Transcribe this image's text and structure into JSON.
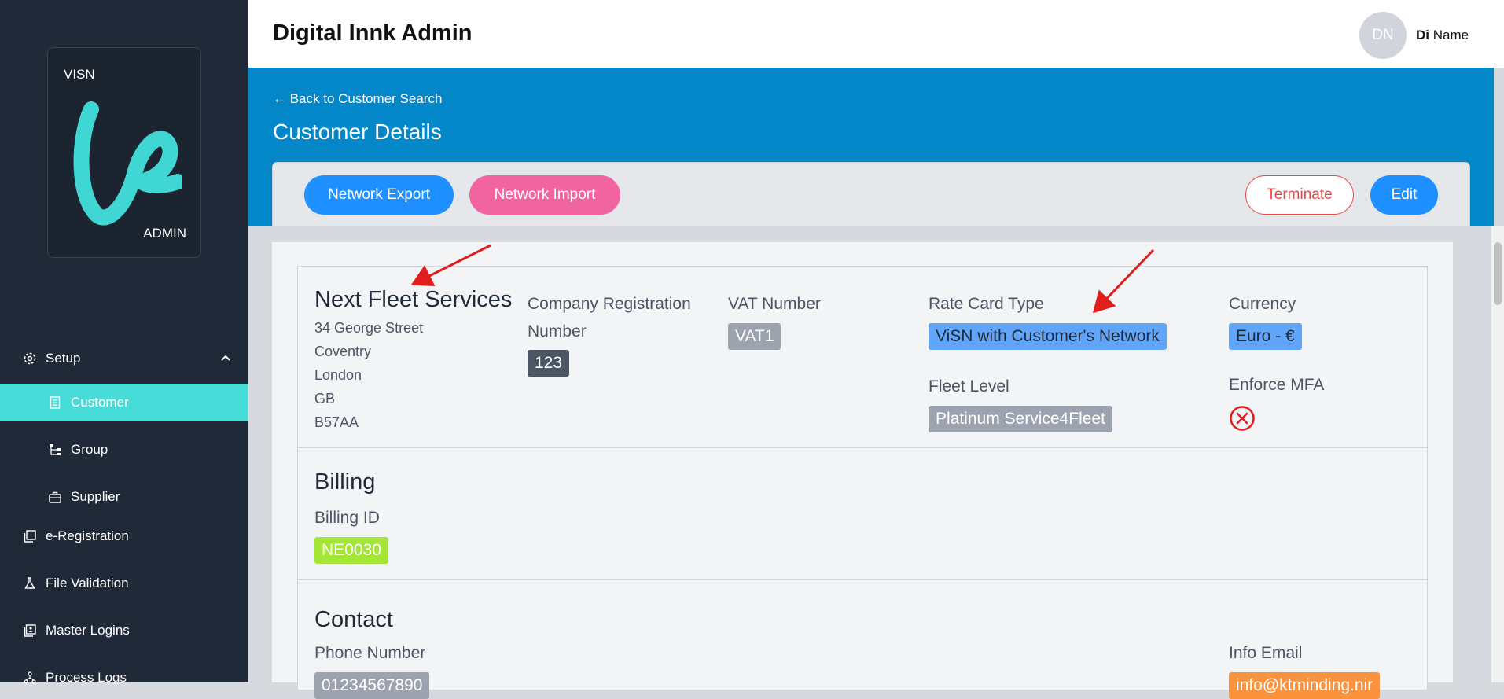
{
  "sidebar": {
    "logo": {
      "top_text": "VISN",
      "bottom_text": "ADMIN"
    },
    "setup_label": "Setup",
    "items": [
      {
        "label": "Customer",
        "icon": "document-icon",
        "active": true
      },
      {
        "label": "Group",
        "icon": "tree-icon"
      },
      {
        "label": "Supplier",
        "icon": "briefcase-icon"
      }
    ],
    "top_items": [
      {
        "label": "e-Registration",
        "icon": "copy-icon"
      },
      {
        "label": "File Validation",
        "icon": "flask-icon"
      },
      {
        "label": "Master Logins",
        "icon": "id-card-icon"
      },
      {
        "label": "Process Logs",
        "icon": "nodes-icon"
      }
    ]
  },
  "header": {
    "title": "Digital Innk Admin",
    "avatar_initials": "DN",
    "user_bold": "Di",
    "user_rest": "Name"
  },
  "banner": {
    "back_link": "← Back to Customer Search",
    "title": "Customer Details"
  },
  "toolbar": {
    "export": "Network Export",
    "import": "Network Import",
    "terminate": "Terminate",
    "edit": "Edit"
  },
  "company": {
    "name": "Next Fleet Services",
    "address": [
      "34 George Street",
      "Coventry",
      "London",
      "GB",
      "B57AA"
    ],
    "reg_label_1": "Company Registration",
    "reg_label_2": "Number",
    "reg_value": "123",
    "vat_label": "VAT Number",
    "vat_value": "VAT1",
    "rate_label": "Rate Card Type",
    "rate_value": "ViSN with Customer's Network",
    "currency_label": "Currency",
    "currency_value": "Euro - €",
    "fleet_label": "Fleet Level",
    "fleet_value": "Platinum Service4Fleet",
    "mfa_label": "Enforce MFA"
  },
  "billing": {
    "title": "Billing",
    "id_label": "Billing ID",
    "id_value": "NE0030"
  },
  "contact": {
    "title": "Contact",
    "phone_label": "Phone Number",
    "phone_value": "01234567890",
    "email_label": "Info Email",
    "email_value": "info@ktminding.nir"
  },
  "colors": {
    "sidebar": "#1f2937",
    "active": "#48dcd9",
    "banner": "#0387c9",
    "primary": "#1e90ff",
    "pink": "#f2649f",
    "danger": "#ef4444",
    "annotation": "#e11d1d"
  }
}
